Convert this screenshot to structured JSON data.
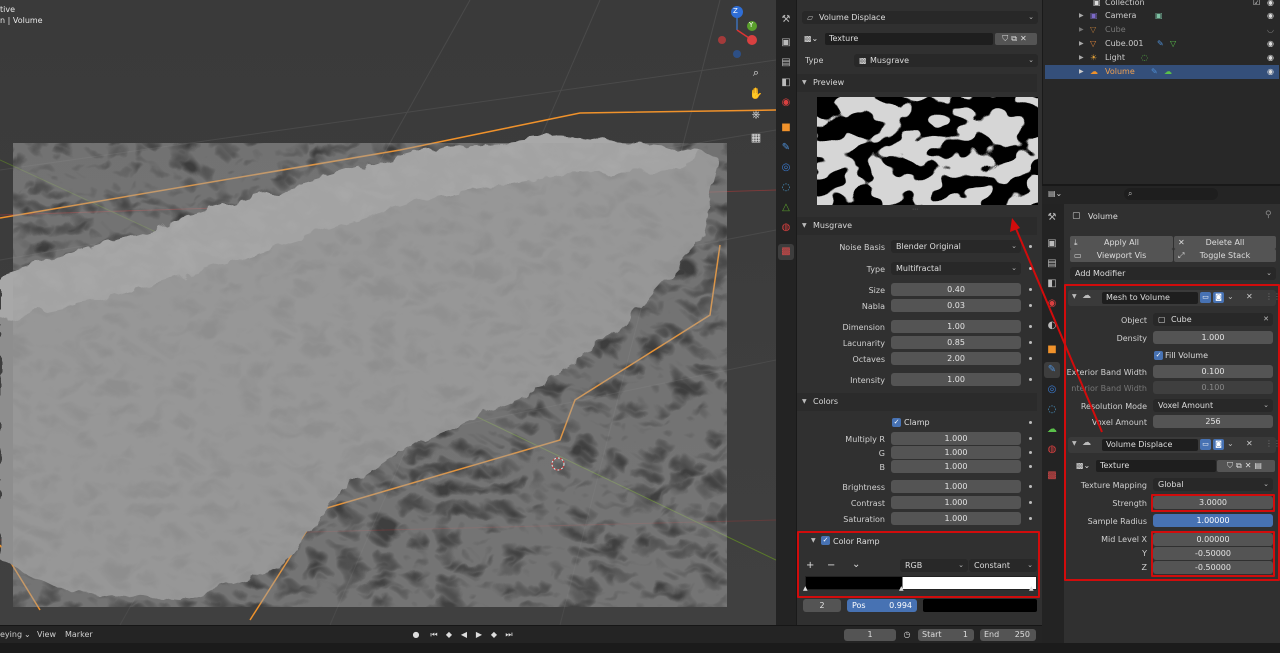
{
  "viewport": {
    "info_line1": "tive",
    "info_line2": "n | Volume",
    "gizmo": {
      "z": "Z",
      "y": "Y"
    },
    "nav_icons": [
      "zoom-icon",
      "hand-icon",
      "camera-icon",
      "grid-icon"
    ]
  },
  "timeline": {
    "menu": [
      "eying",
      "View",
      "Marker"
    ],
    "current_frame": "1",
    "start_label": "Start",
    "start_value": "1",
    "end_label": "End",
    "end_value": "250"
  },
  "texture_panel": {
    "header_dropdown": "Volume Displace",
    "texture_name": "Texture",
    "type_label": "Type",
    "type_value": "Musgrave",
    "preview_label": "Preview",
    "musgrave_label": "Musgrave",
    "fields": {
      "noise_basis_label": "Noise Basis",
      "noise_basis_value": "Blender Original",
      "type_label": "Type",
      "type_value": "Multifractal",
      "size_label": "Size",
      "size_value": "0.40",
      "nabla_label": "Nabla",
      "nabla_value": "0.03",
      "dimension_label": "Dimension",
      "dimension_value": "1.00",
      "lacunarity_label": "Lacunarity",
      "lacunarity_value": "0.85",
      "octaves_label": "Octaves",
      "octaves_value": "2.00",
      "intensity_label": "Intensity",
      "intensity_value": "1.00"
    },
    "colors_label": "Colors",
    "colors": {
      "clamp_label": "Clamp",
      "multiply_r_label": "Multiply R",
      "multiply_r_value": "1.000",
      "g_label": "G",
      "g_value": "1.000",
      "b_label": "B",
      "b_value": "1.000",
      "brightness_label": "Brightness",
      "brightness_value": "1.000",
      "contrast_label": "Contrast",
      "contrast_value": "1.000",
      "saturation_label": "Saturation",
      "saturation_value": "1.000"
    },
    "color_ramp": {
      "label": "Color Ramp",
      "plus": "+",
      "minus": "−",
      "menu": "⌄",
      "mode": "RGB",
      "interp": "Constant",
      "index": "2",
      "pos_label": "Pos",
      "pos_value": "0.994"
    }
  },
  "outliner": {
    "items": [
      {
        "name": "Collection"
      },
      {
        "name": "Camera"
      },
      {
        "name": "Cube"
      },
      {
        "name": "Cube.001"
      },
      {
        "name": "Light"
      },
      {
        "name": "Volume"
      }
    ]
  },
  "properties": {
    "object_name": "Volume",
    "apply_all": "Apply All",
    "delete_all": "Delete All",
    "viewport_vis": "Viewport Vis",
    "toggle_stack": "Toggle Stack",
    "add_modifier": "Add Modifier",
    "mesh_to_volume": {
      "name": "Mesh to Volume",
      "object_label": "Object",
      "object_value": "Cube",
      "density_label": "Density",
      "density_value": "1.000",
      "fill_volume_label": "Fill Volume",
      "exterior_label": "Exterior Band Width",
      "exterior_value": "0.100",
      "interior_label": "nterior Band Width",
      "interior_value": "0.100",
      "resolution_label": "Resolution Mode",
      "resolution_value": "Voxel Amount",
      "voxel_label": "Voxel Amount",
      "voxel_value": "256"
    },
    "volume_displace": {
      "name": "Volume Displace",
      "texture_value": "Texture",
      "mapping_label": "Texture Mapping",
      "mapping_value": "Global",
      "strength_label": "Strength",
      "strength_value": "3.0000",
      "sample_label": "Sample Radius",
      "sample_value": "1.00000",
      "mid_x_label": "Mid Level X",
      "mid_x_value": "0.00000",
      "mid_y_label": "Y",
      "mid_y_value": "-0.50000",
      "mid_z_label": "Z",
      "mid_z_value": "-0.50000"
    }
  },
  "colors": {
    "accent": "#4772b3",
    "annotation": "#d10c0c",
    "selection_orange": "#f0922b"
  }
}
